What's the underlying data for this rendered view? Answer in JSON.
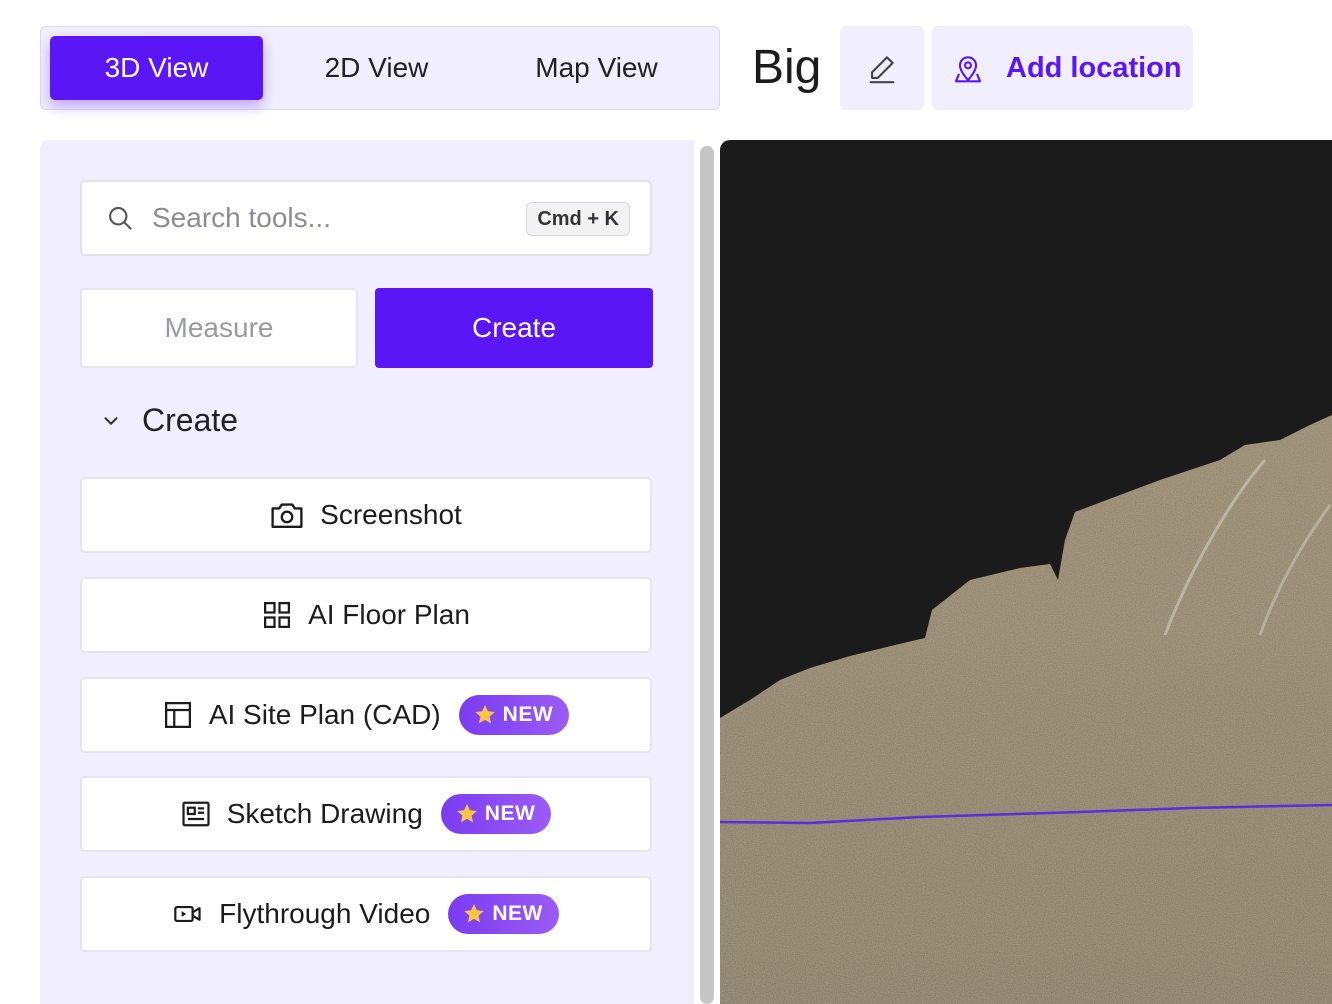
{
  "view_tabs": [
    {
      "label": "3D View",
      "active": true
    },
    {
      "label": "2D View",
      "active": false
    },
    {
      "label": "Map View",
      "active": false
    }
  ],
  "project": {
    "title": "Big"
  },
  "toolbar": {
    "add_location_label": "Add location"
  },
  "search": {
    "placeholder": "Search tools...",
    "shortcut": "Cmd + K"
  },
  "mode_toggle": {
    "measure_label": "Measure",
    "create_label": "Create",
    "active": "Create"
  },
  "section": {
    "title": "Create",
    "expanded": true
  },
  "tools": [
    {
      "label": "Screenshot",
      "icon": "camera-icon",
      "is_new": false
    },
    {
      "label": "AI Floor Plan",
      "icon": "grid-icon",
      "is_new": false
    },
    {
      "label": "AI Site Plan (CAD)",
      "icon": "layout-icon",
      "is_new": true
    },
    {
      "label": "Sketch Drawing",
      "icon": "newspaper-icon",
      "is_new": true
    },
    {
      "label": "Flythrough Video",
      "icon": "video-icon",
      "is_new": true
    }
  ],
  "badge": {
    "label": "NEW",
    "icon": "star-icon"
  },
  "colors": {
    "accent": "#5a16f5",
    "panel_bg": "#f1efff",
    "viewport_bg": "#1b1b1b",
    "terrain": "#8d7d62",
    "guide_line": "#5a2ee0"
  }
}
